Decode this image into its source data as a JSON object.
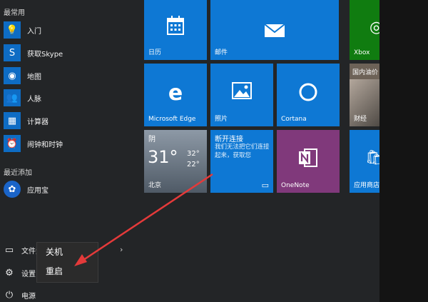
{
  "left": {
    "frequent_label": "最常用",
    "recent_label": "最近添加",
    "frequent": [
      {
        "label": "入门",
        "icon": "lightbulb-icon",
        "glyph": "💡"
      },
      {
        "label": "获取Skype",
        "icon": "skype-icon",
        "glyph": "S"
      },
      {
        "label": "地图",
        "icon": "maps-icon",
        "glyph": "◉"
      },
      {
        "label": "人脉",
        "icon": "people-icon",
        "glyph": "👥"
      },
      {
        "label": "计算器",
        "icon": "calculator-icon",
        "glyph": "▦"
      },
      {
        "label": "闹钟和时钟",
        "icon": "alarm-icon",
        "glyph": "⏰"
      }
    ],
    "recent": [
      {
        "label": "应用宝",
        "icon": "yingyongbao-icon",
        "glyph": "✿"
      }
    ],
    "system": {
      "file_explorer": "文件资",
      "settings": "设置",
      "power": "电源"
    }
  },
  "power_menu": {
    "items": [
      "关机",
      "重启"
    ]
  },
  "tiles": {
    "calendar": "日历",
    "mail": "邮件",
    "xbox": "Xbox",
    "edge": "Microsoft Edge",
    "photos": "照片",
    "cortana": "Cortana",
    "news": "国内油价",
    "finance": "财经",
    "weather_condition": "阴",
    "weather_temp": "31°",
    "weather_high": "32°",
    "weather_low": "22°",
    "weather_city": "北京",
    "msg_title": "断开连接",
    "msg_body": "我们无法把它们连接起来，获取您",
    "onenote": "OneNote",
    "store": "应用商店"
  },
  "colors": {
    "accent": "#0e78d4",
    "onenote": "#80397b",
    "annotation": "#e43a3a"
  }
}
